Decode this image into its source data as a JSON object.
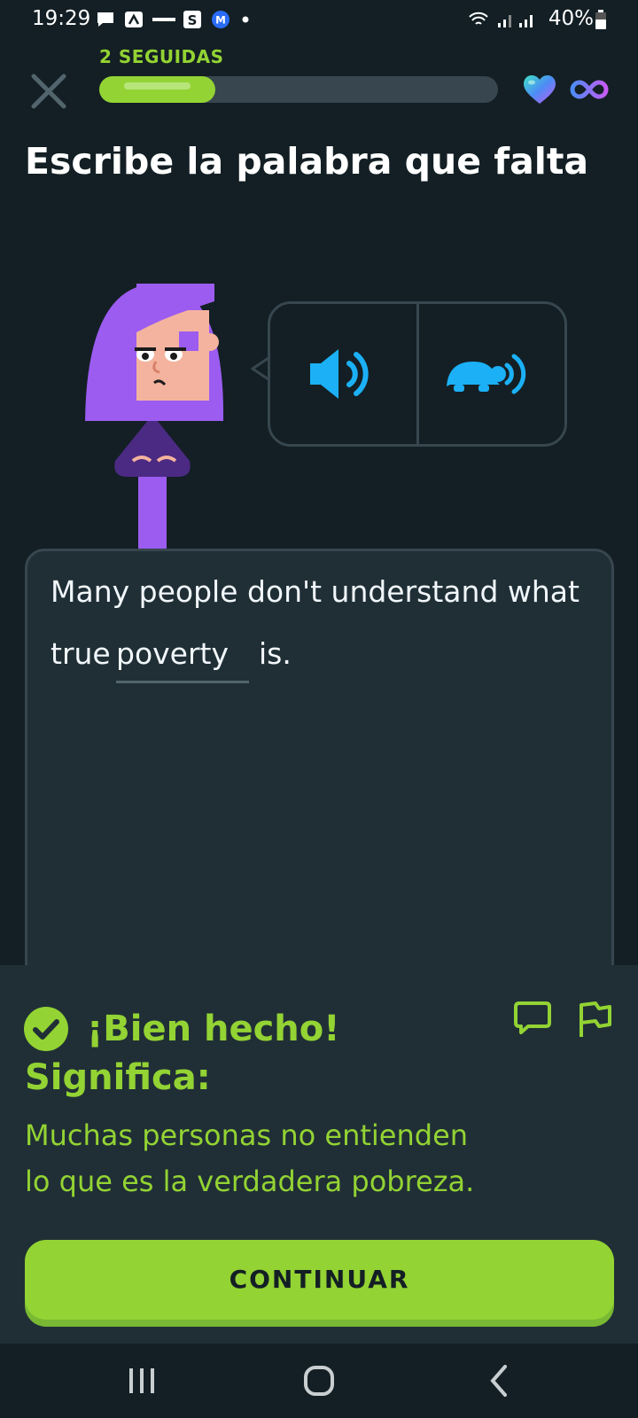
{
  "status_bar": {
    "time": "19:29",
    "battery": "40%",
    "notification_icons": [
      "chat-icon",
      "arrow-up-icon",
      "compass-icon",
      "s-app-icon",
      "m-app-icon"
    ]
  },
  "header": {
    "streak_label": "2 SEGUIDAS",
    "progress": 0.29,
    "hearts": "infinite"
  },
  "prompt": {
    "title": "Escribe la palabra que falta"
  },
  "sentence": {
    "line1": "Many people don't understand what",
    "before_blank": "true",
    "answer": "poverty",
    "after_blank": "is."
  },
  "feedback": {
    "title": "¡Bien hecho!",
    "meaning_label": "Significa:",
    "translation_line1": "Muchas personas no entienden",
    "translation_line2": "lo que es la verdadera pobreza."
  },
  "actions": {
    "continue_label": "CONTINUAR"
  },
  "colors": {
    "background": "#131f24",
    "accent_green": "#93d333",
    "audio_blue": "#1cb0f6",
    "panel": "#202f36"
  }
}
